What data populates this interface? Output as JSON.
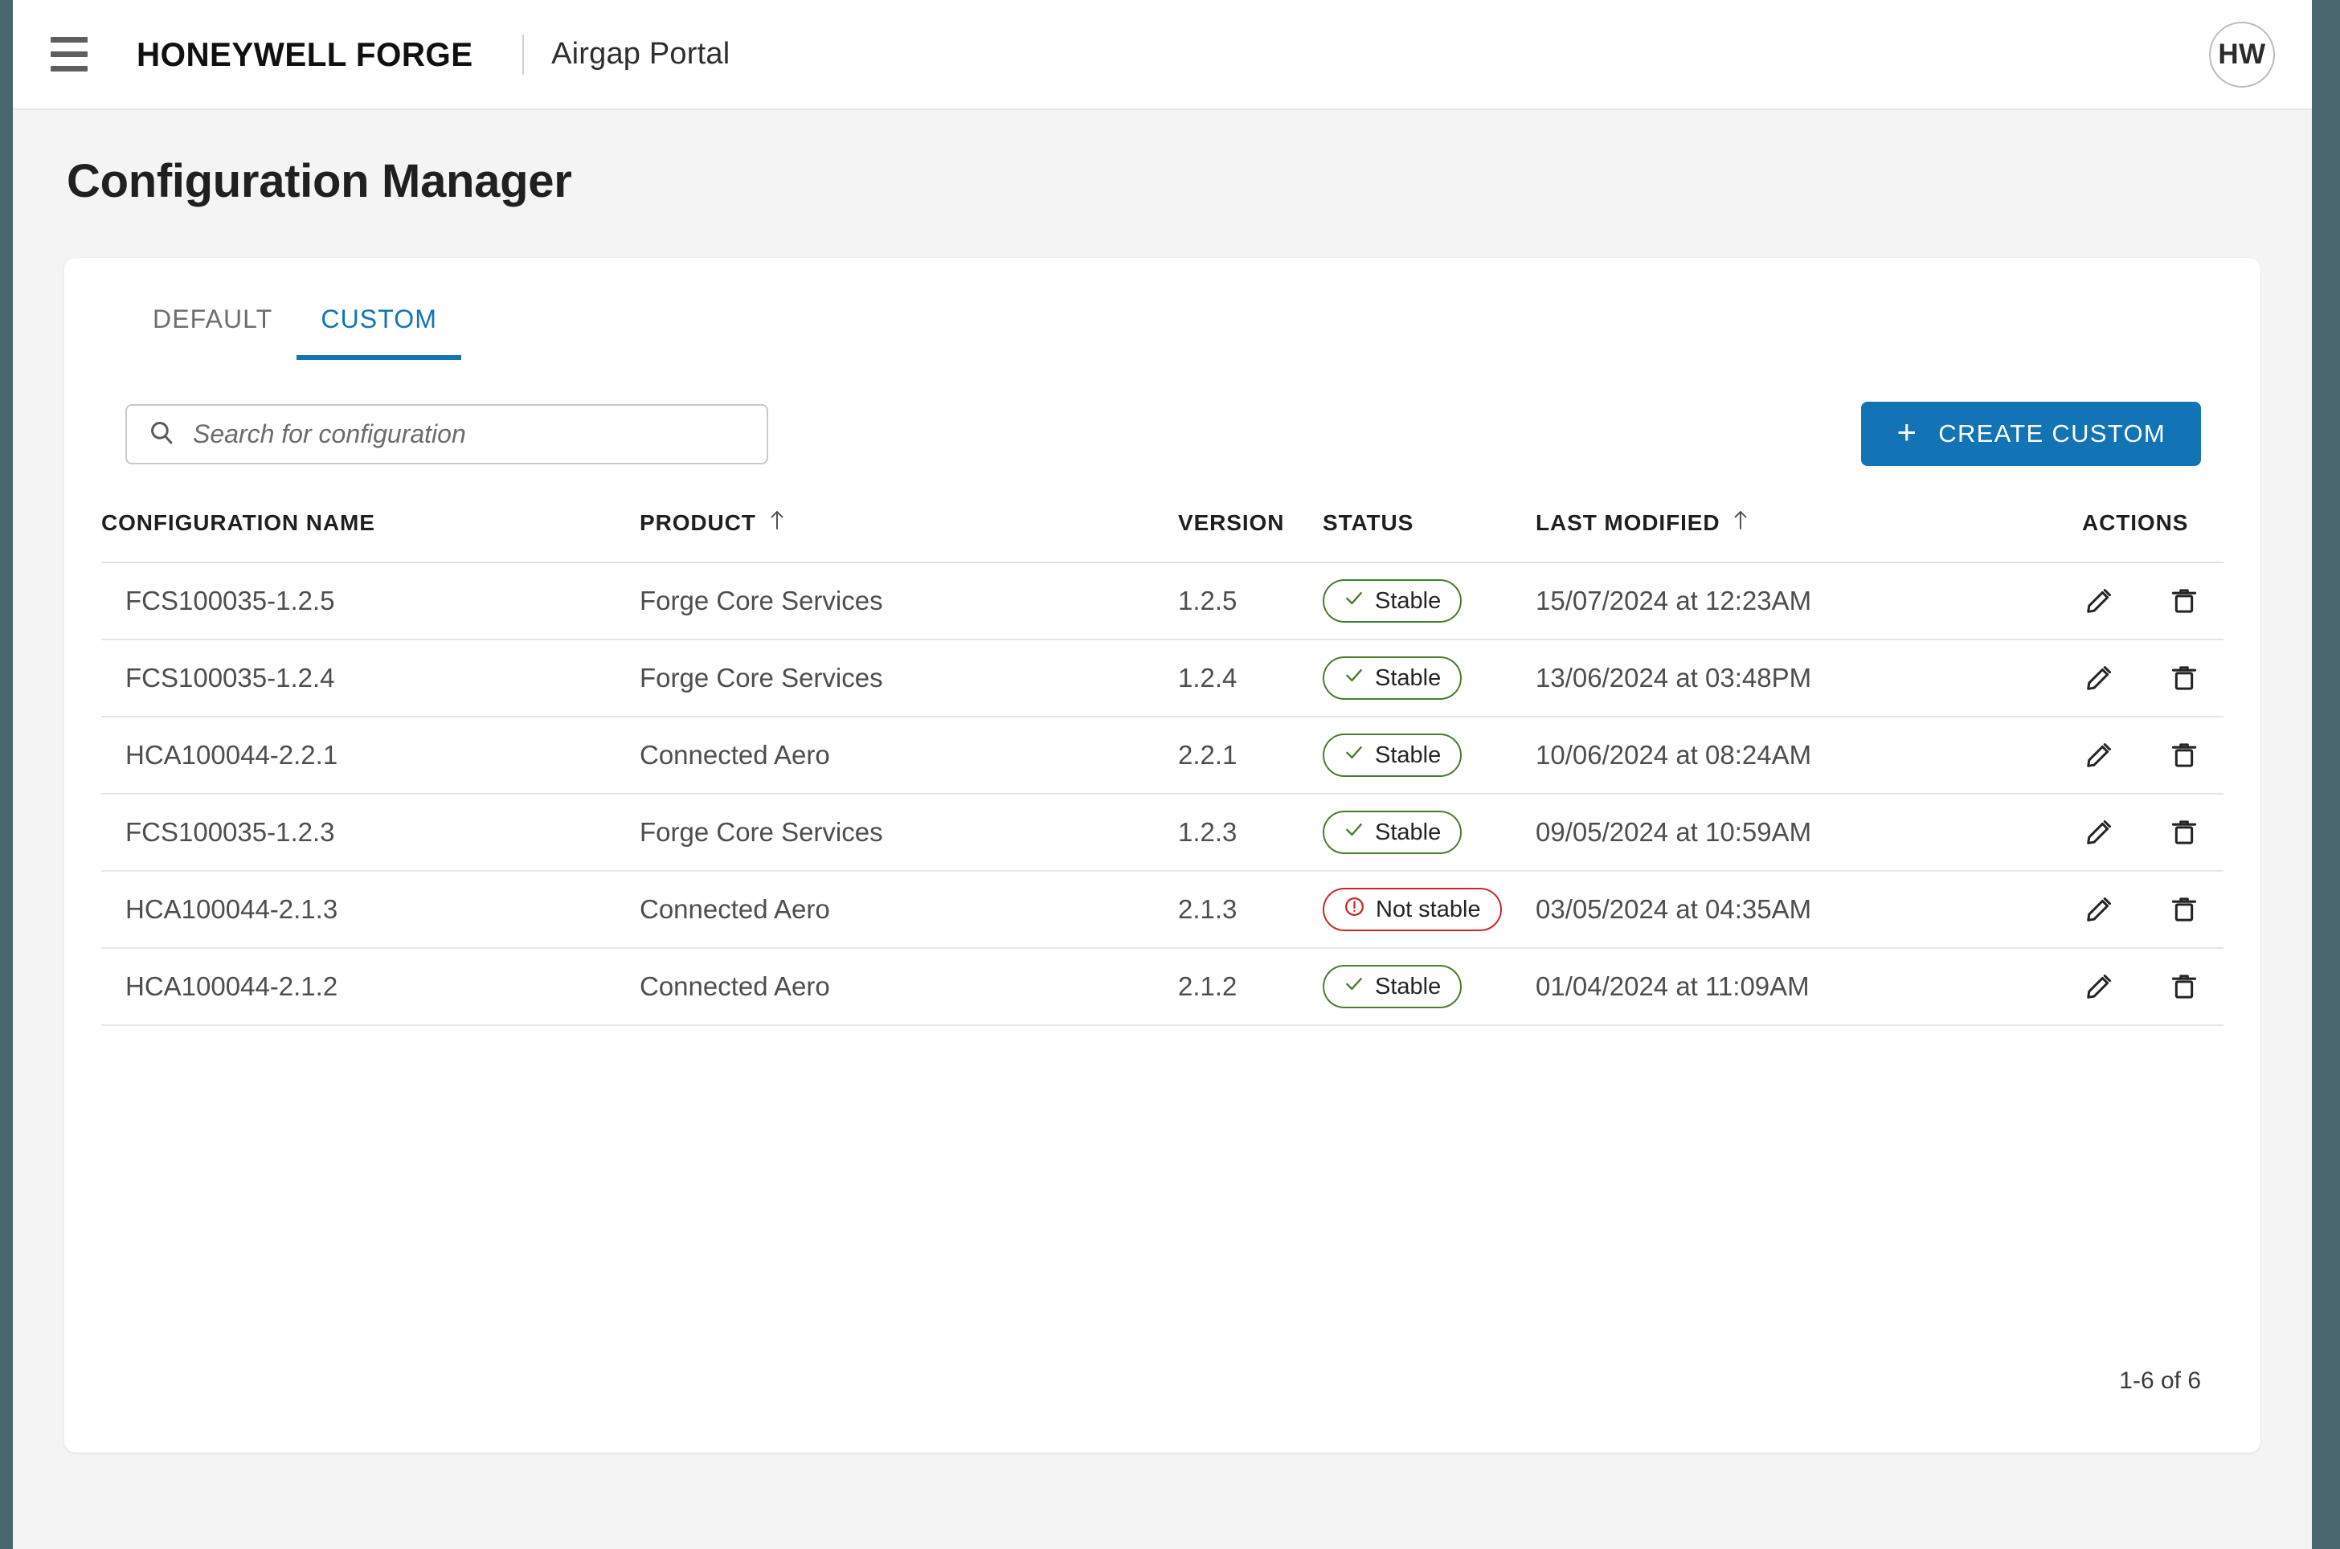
{
  "appbar": {
    "menu_icon": "hamburger-menu-icon",
    "brand": "HONEYWELL FORGE",
    "subbrand": "Airgap Portal",
    "avatar_initials": "HW"
  },
  "page": {
    "title": "Configuration Manager"
  },
  "tabs": [
    {
      "label": "DEFAULT",
      "active": false
    },
    {
      "label": "CUSTOM",
      "active": true
    }
  ],
  "search": {
    "icon": "search-icon",
    "placeholder": "Search for configuration",
    "value": ""
  },
  "create_button": {
    "icon": "plus-icon",
    "label": "CREATE CUSTOM"
  },
  "table": {
    "headers": {
      "name": "CONFIGURATION NAME",
      "product": "PRODUCT",
      "version": "VERSION",
      "status": "STATUS",
      "modified": "LAST MODIFIED",
      "actions": "ACTIONS"
    },
    "sorted_columns": [
      "product",
      "modified"
    ],
    "rows": [
      {
        "name": "FCS100035-1.2.5",
        "product": "Forge Core Services",
        "version": "1.2.5",
        "status": "Stable",
        "status_type": "stable",
        "modified": "15/07/2024 at 12:23AM"
      },
      {
        "name": "FCS100035-1.2.4",
        "product": "Forge Core Services",
        "version": "1.2.4",
        "status": "Stable",
        "status_type": "stable",
        "modified": "13/06/2024 at 03:48PM"
      },
      {
        "name": "HCA100044-2.2.1",
        "product": "Connected Aero",
        "version": "2.2.1",
        "status": "Stable",
        "status_type": "stable",
        "modified": "10/06/2024 at 08:24AM"
      },
      {
        "name": "FCS100035-1.2.3",
        "product": "Forge Core Services",
        "version": "1.2.3",
        "status": "Stable",
        "status_type": "stable",
        "modified": "09/05/2024 at 10:59AM"
      },
      {
        "name": "HCA100044-2.1.3",
        "product": "Connected Aero",
        "version": "2.1.3",
        "status": "Not stable",
        "status_type": "notstable",
        "modified": "03/05/2024 at 04:35AM"
      },
      {
        "name": "HCA100044-2.1.2",
        "product": "Connected Aero",
        "version": "2.1.2",
        "status": "Stable",
        "status_type": "stable",
        "modified": "01/04/2024 at 11:09AM"
      }
    ],
    "row_actions": [
      {
        "icon": "edit-pencil-icon"
      },
      {
        "icon": "delete-trash-icon"
      }
    ]
  },
  "pagination": {
    "range_label": "1-6 of 6"
  },
  "colors": {
    "accent_blue": "#1274b5",
    "frame_slate": "#4a666f",
    "page_bg": "#f4f4f4",
    "status_stable": "#4a7c2f",
    "status_not_stable": "#c62828"
  }
}
